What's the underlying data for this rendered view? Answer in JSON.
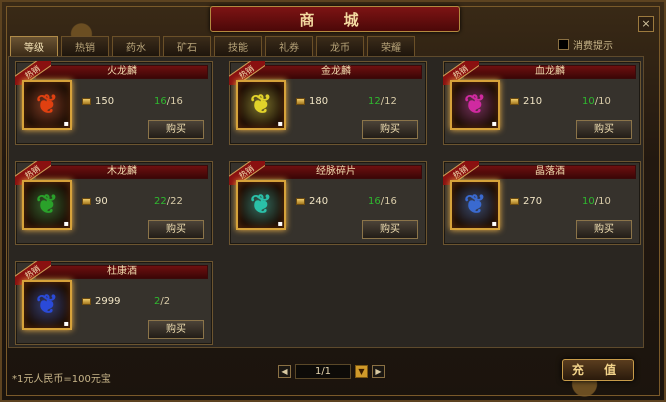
{
  "window": {
    "title": "商 城",
    "close_label": "×"
  },
  "tabs": [
    "等级",
    "热销",
    "药水",
    "矿石",
    "技能",
    "礼券",
    "龙币",
    "荣耀"
  ],
  "active_tab": 0,
  "consume_prompt": "消费提示",
  "hot_label": "热销",
  "buy_label": "购买",
  "items": [
    {
      "name": "火龙麟",
      "price": "150",
      "stock_current": "16",
      "stock_total": "/16",
      "icon": "fire-scale-icon",
      "color": "#e04010"
    },
    {
      "name": "金龙麟",
      "price": "180",
      "stock_current": "12",
      "stock_total": "/12",
      "icon": "gold-scale-icon",
      "color": "#e2d32a"
    },
    {
      "name": "血龙麟",
      "price": "210",
      "stock_current": "10",
      "stock_total": "/10",
      "icon": "blood-scale-icon",
      "color": "#d02aa0"
    },
    {
      "name": "木龙麟",
      "price": "90",
      "stock_current": "22",
      "stock_total": "/22",
      "icon": "wood-scale-icon",
      "color": "#2aa12a"
    },
    {
      "name": "经脉碎片",
      "price": "240",
      "stock_current": "16",
      "stock_total": "/16",
      "icon": "meridian-shard-icon",
      "color": "#2ac0a8"
    },
    {
      "name": "晶落酒",
      "price": "270",
      "stock_current": "10",
      "stock_total": "/10",
      "icon": "crystal-wine-icon",
      "color": "#3a6ad0"
    },
    {
      "name": "杜康酒",
      "price": "2999",
      "stock_current": "2",
      "stock_total": "/2",
      "icon": "dukang-wine-icon",
      "color": "#2a4ad8"
    }
  ],
  "footer": {
    "rate": "1元人民币=100元宝",
    "page": "1/1",
    "prev": "◀",
    "next": "▶",
    "dropdown": "▼",
    "recharge": "充 值"
  }
}
